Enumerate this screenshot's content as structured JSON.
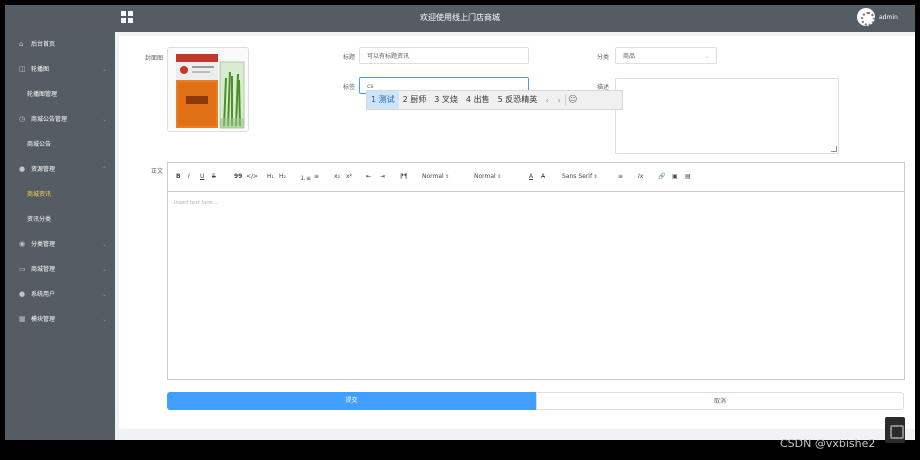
{
  "header": {
    "title": "欢迎使用线上门店商城",
    "username": "admin"
  },
  "sidebar": {
    "items": [
      {
        "label": "后台首页",
        "icon": "home-icon",
        "type": "top",
        "arrow": false
      },
      {
        "label": "轮播图",
        "icon": "carousel-icon",
        "type": "group",
        "arrow": true
      },
      {
        "label": "轮播图管理",
        "type": "sub"
      },
      {
        "label": "商城公告管理",
        "icon": "notice-icon",
        "type": "group",
        "arrow": true
      },
      {
        "label": "商城公告",
        "type": "sub"
      },
      {
        "label": "资源管理",
        "icon": "location-icon",
        "type": "group",
        "arrow": true
      },
      {
        "label": "商城资讯",
        "type": "sub",
        "active": true
      },
      {
        "label": "资讯分类",
        "type": "sub"
      },
      {
        "label": "分类管理",
        "icon": "category-icon",
        "type": "group",
        "arrow": true
      },
      {
        "label": "商城管理",
        "icon": "shop-icon",
        "type": "group",
        "arrow": true
      },
      {
        "label": "系统用户",
        "icon": "user-icon",
        "type": "group",
        "arrow": true
      },
      {
        "label": "模块管理",
        "icon": "module-icon",
        "type": "group",
        "arrow": true
      }
    ]
  },
  "form": {
    "cover_label": "封面图",
    "title_label": "标题",
    "title_value": "可以有标题资讯",
    "category_label": "分类",
    "category_value": "商品",
    "tags_label": "标签",
    "tags_value": "cs",
    "desc_label": "描述",
    "body_label": "正文",
    "editor_placeholder": "Insert text here ..."
  },
  "ime": {
    "candidates": [
      {
        "num": "1",
        "text": "测试",
        "selected": true
      },
      {
        "num": "2",
        "text": "厨师"
      },
      {
        "num": "3",
        "text": "叉烧"
      },
      {
        "num": "4",
        "text": "出售"
      },
      {
        "num": "5",
        "text": "反恐精英"
      }
    ]
  },
  "toolbar": {
    "bold": "B",
    "italic": "I",
    "underline": "U",
    "strike": "S",
    "quote": "99",
    "code": "</>",
    "h1": "H₁",
    "h2": "H₂",
    "ordered_list": "⒈≡",
    "bullet_list": "≡",
    "subscript": "x₂",
    "superscript": "x²",
    "indent_dec": "⇤",
    "indent_inc": "⇥",
    "direction": "⁋¶",
    "size": "Normal",
    "header": "Normal",
    "color": "A",
    "background": "A̶",
    "font": "Sans Serif",
    "align": "≡",
    "clean": "Ix",
    "link": "🔗",
    "image": "▣",
    "video": "▤"
  },
  "buttons": {
    "submit": "提交",
    "cancel": "取消"
  },
  "watermark": "CSDN @vxbishe2"
}
